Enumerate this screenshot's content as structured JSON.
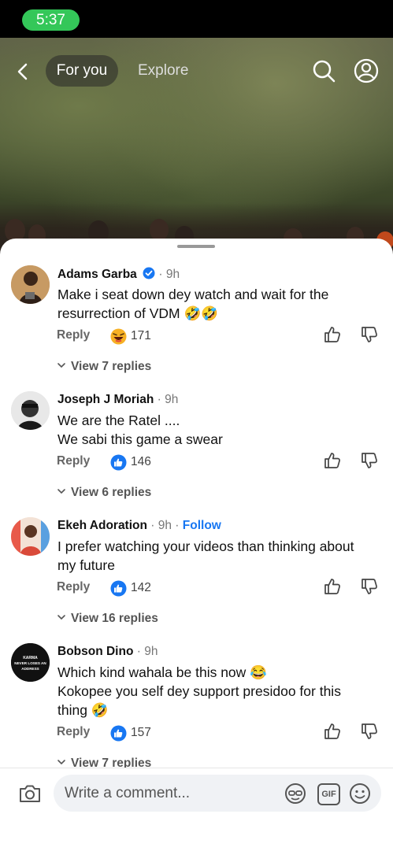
{
  "status_bar": {
    "time": "5:37"
  },
  "top_nav": {
    "tabs": [
      {
        "label": "For you",
        "active": true
      },
      {
        "label": "Explore",
        "active": false
      }
    ]
  },
  "comments": [
    {
      "author": "Adams Garba",
      "verified": true,
      "time": "· 9h",
      "follow": "",
      "lines": [
        "Make i seat down dey watch and wait for the",
        "resurrection of VDM 🤣🤣"
      ],
      "reply_label": "Reply",
      "reaction": "haha",
      "count": "171",
      "view_replies": "View 7 replies"
    },
    {
      "author": "Joseph J Moriah",
      "verified": false,
      "time": "· 9h",
      "follow": "",
      "lines": [
        "We are the Ratel ....",
        "We sabi this game a swear"
      ],
      "reply_label": "Reply",
      "reaction": "like",
      "count": "146",
      "view_replies": "View 6 replies"
    },
    {
      "author": "Ekeh Adoration",
      "verified": false,
      "time": "· 9h ·",
      "follow": "Follow",
      "lines": [
        "I prefer watching your videos than thinking about",
        "my future"
      ],
      "reply_label": "Reply",
      "reaction": "like",
      "count": "142",
      "view_replies": "View 16 replies"
    },
    {
      "author": "Bobson Dino",
      "verified": false,
      "time": "· 9h",
      "follow": "",
      "lines": [
        "Which kind wahala be this now 😂",
        "Kokopee you self dey support presidoo for this",
        "thing 🤣"
      ],
      "reply_label": "Reply",
      "reaction": "like",
      "count": "157",
      "view_replies": "View 7 replies",
      "avatar_text": [
        "KARMA",
        "NEVER LOSES AN",
        "ADDRESS"
      ]
    }
  ],
  "composer": {
    "placeholder": "Write a comment...",
    "gif_label": "GIF"
  },
  "colors": {
    "accent": "#1877f2",
    "status_pill": "#34c759"
  }
}
